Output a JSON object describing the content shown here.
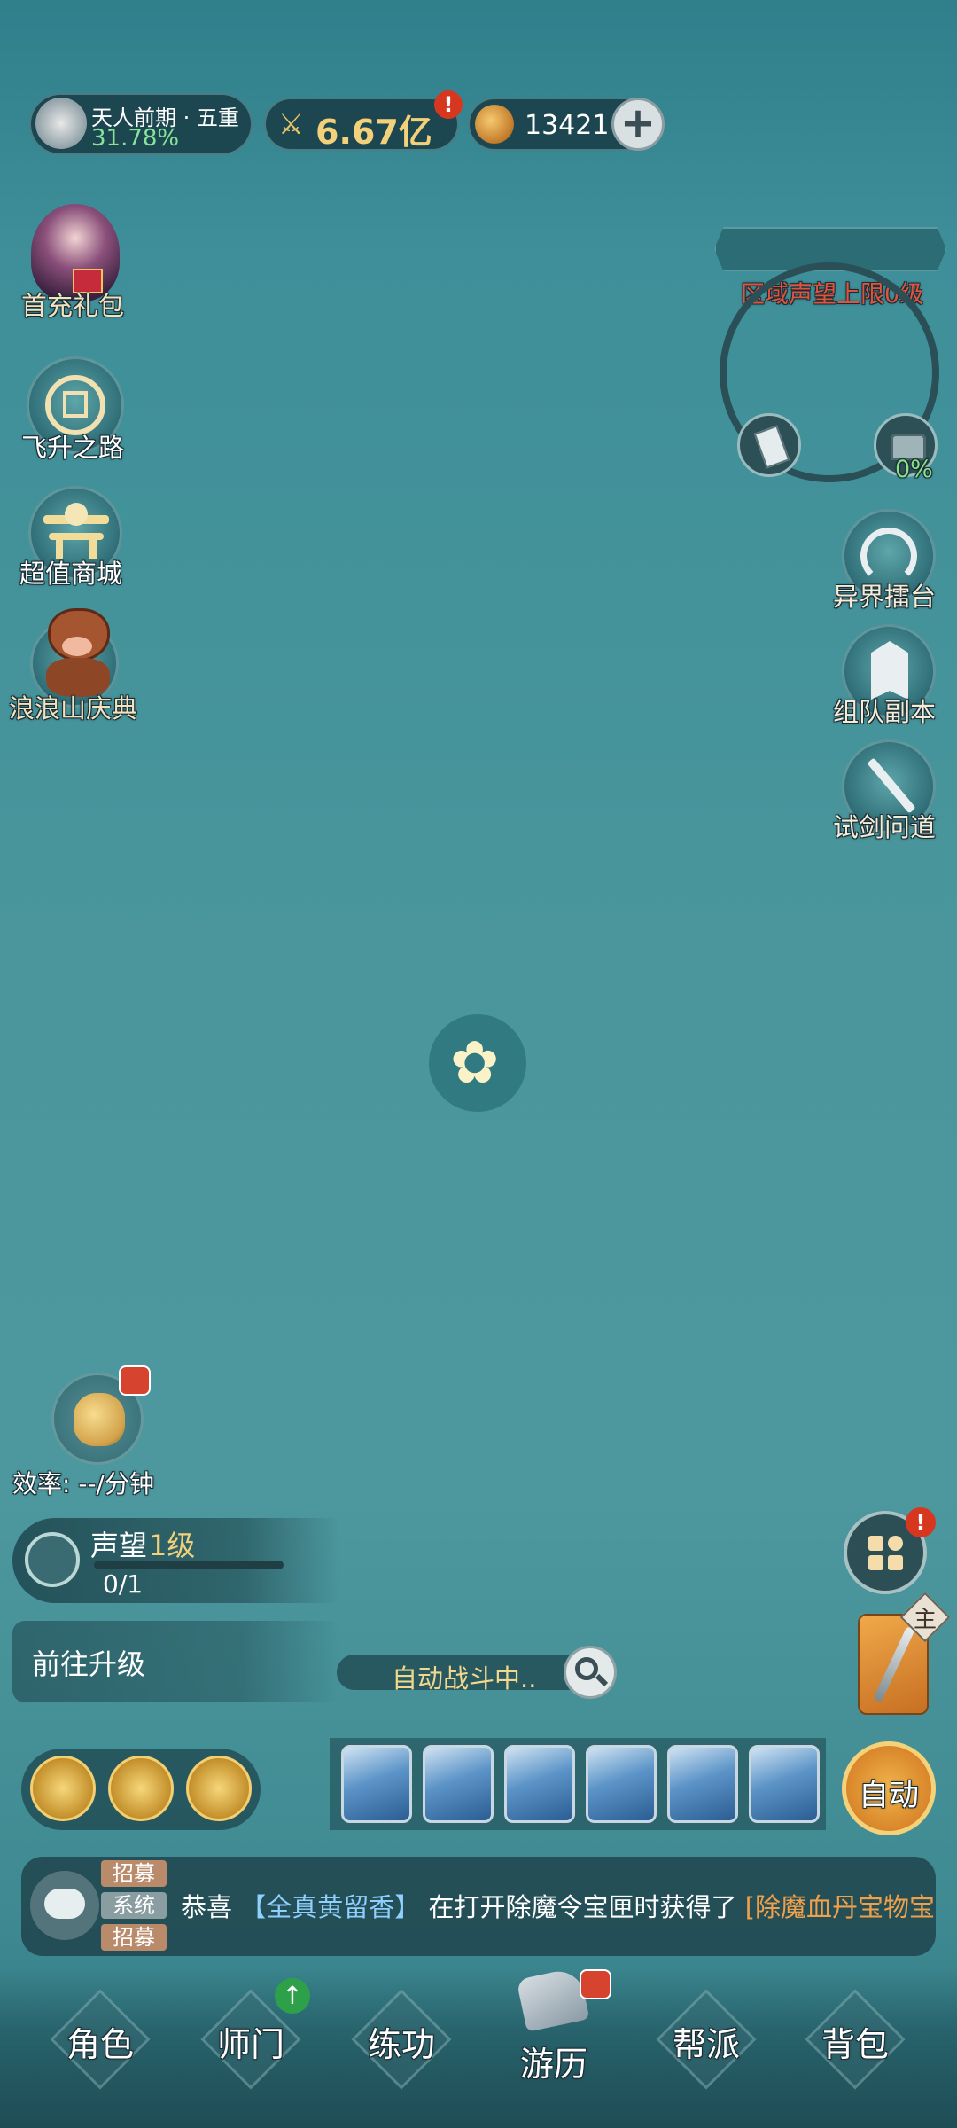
{
  "status": {
    "realm": "天人前期 · 五重",
    "realm_percent": "31.78%",
    "combat_power": "6.67亿",
    "currency": "13421",
    "accent_gold": "#f3d07a"
  },
  "left_menu": [
    {
      "label": "首充礼包",
      "icon": "gift-character-icon"
    },
    {
      "label": "飞升之路",
      "icon": "ascension-emblem-icon"
    },
    {
      "label": "超值商城",
      "icon": "pavilion-shop-icon"
    },
    {
      "label": "浪浪山庆典",
      "icon": "boar-mascot-icon"
    }
  ],
  "region": {
    "limit_text": "区域声望上限0级",
    "progress_text": "0%"
  },
  "right_menu": [
    {
      "label": "异界擂台",
      "icon": "arena-icon"
    },
    {
      "label": "组队副本",
      "icon": "team-dungeon-icon"
    },
    {
      "label": "试剑问道",
      "icon": "sword-trial-icon"
    }
  ],
  "efficiency": {
    "text": "效率: --/分钟"
  },
  "reputation": {
    "title_prefix": "声望",
    "level": "1级",
    "progress": "0/1",
    "progress_fraction": 0
  },
  "upgrade_button": "前往升级",
  "auto_battle": "自动战斗中..",
  "main_side_badge": "主",
  "auto_button": "自动",
  "chat": {
    "tags": [
      "招募",
      "系统",
      "招募"
    ],
    "prefix": "恭喜",
    "player": "【全真黄留香】",
    "action": "在打开除魔令宝匣时获得了",
    "item": "[除魔血丹宝物宝"
  },
  "bottom_nav": [
    {
      "label": "角色"
    },
    {
      "label": "师门"
    },
    {
      "label": "练功"
    },
    {
      "label": "游历"
    },
    {
      "label": "帮派"
    },
    {
      "label": "背包"
    }
  ],
  "colors": {
    "chat_player": "#8fd0ff",
    "chat_item": "#f0a04a",
    "region_text": "#e2533f",
    "progress_text": "#88e28a"
  }
}
